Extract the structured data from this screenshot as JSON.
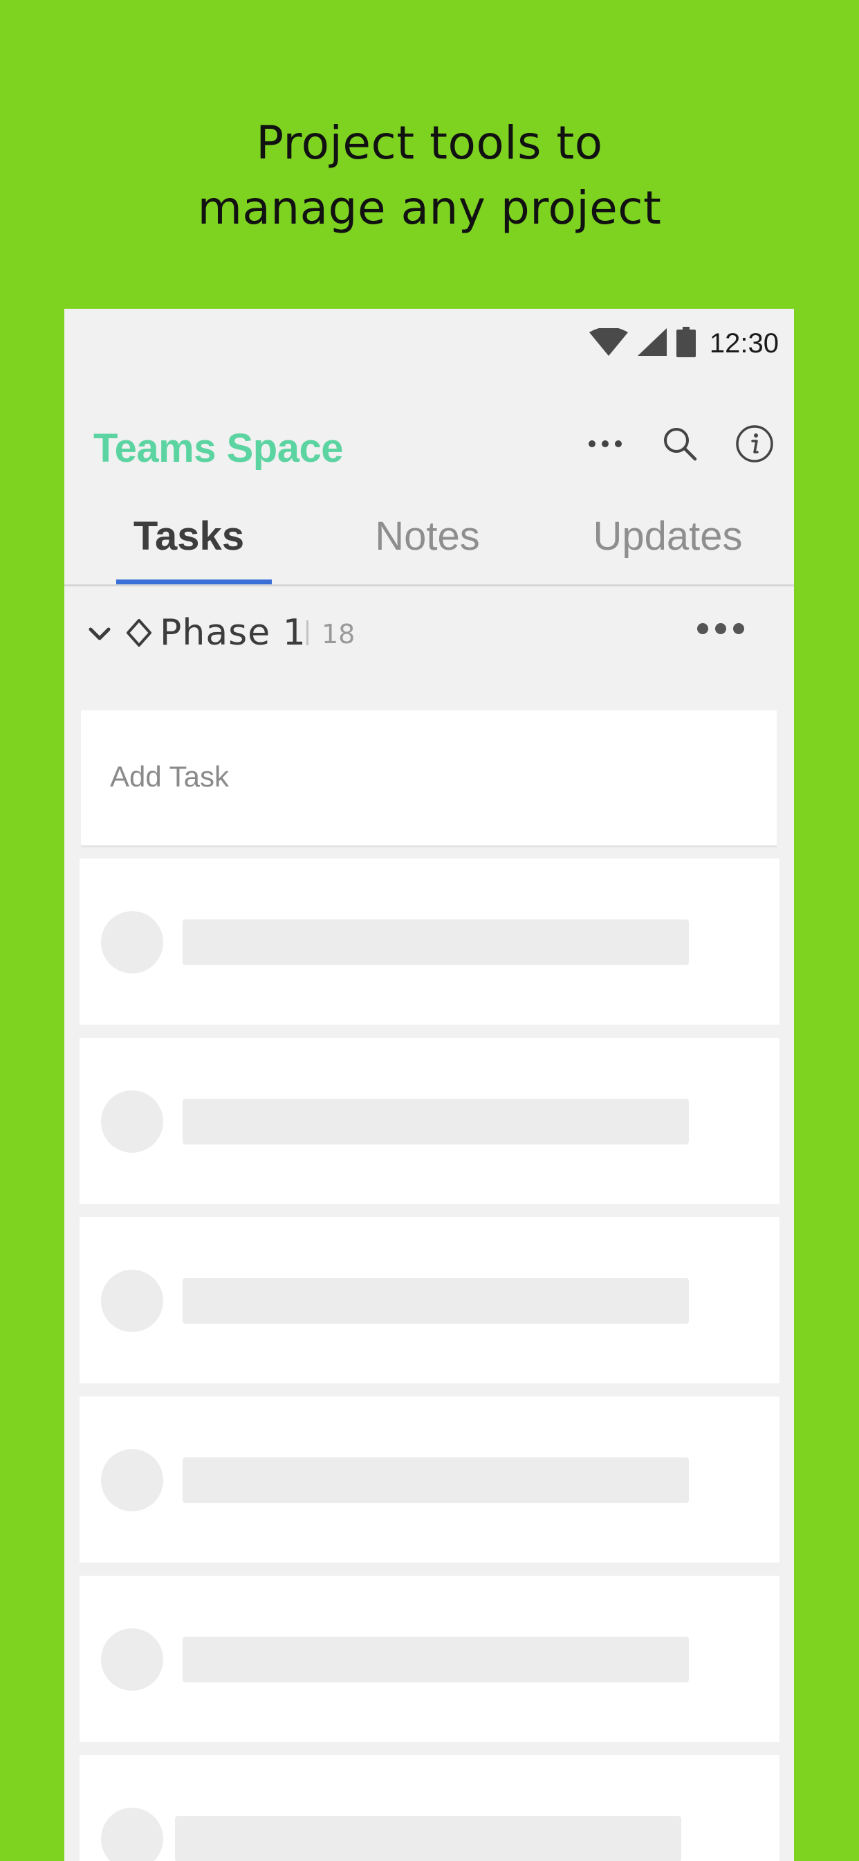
{
  "promo": {
    "headline_line1": "Project tools to",
    "headline_line2": "manage any project",
    "background_color": "#7ed321"
  },
  "status_bar": {
    "time": "12:30",
    "icons": [
      "wifi-icon",
      "cell-signal-icon",
      "battery-icon"
    ]
  },
  "app_bar": {
    "title": "Teams Space",
    "title_color": "#5cd4a1",
    "actions": [
      "more-icon",
      "search-icon",
      "info-icon"
    ]
  },
  "tabs": [
    {
      "label": "Tasks",
      "active": true
    },
    {
      "label": "Notes",
      "active": false
    },
    {
      "label": "Updates",
      "active": false
    }
  ],
  "tab_accent_color": "#3a6fd8",
  "phase": {
    "name": "Phase 1",
    "count": "18"
  },
  "add_task": {
    "placeholder": "Add Task"
  },
  "task_placeholders_visible": 6
}
